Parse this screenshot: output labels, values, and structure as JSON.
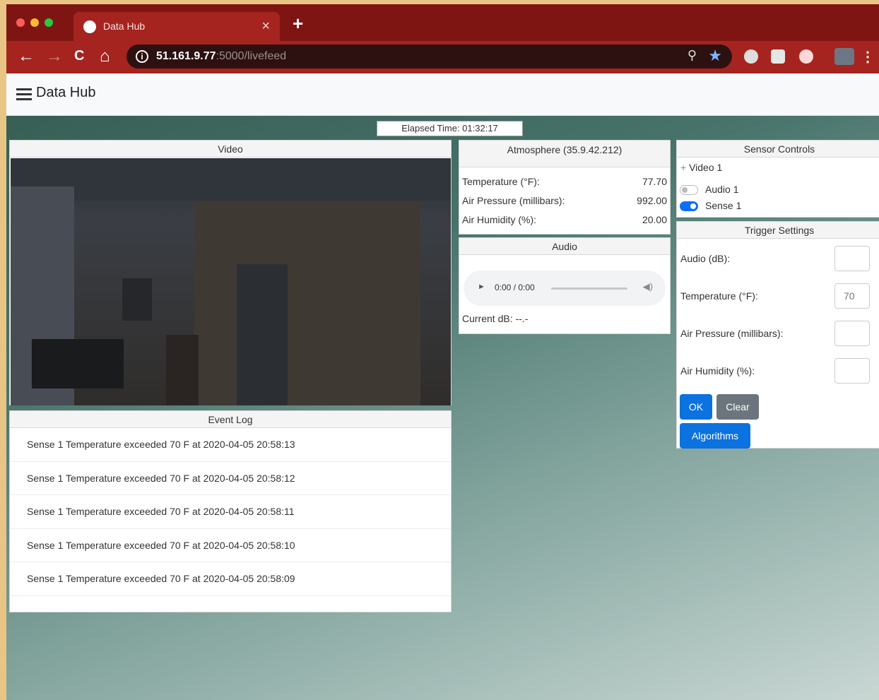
{
  "browser": {
    "tab_title": "Data Hub",
    "tab_close": "×",
    "new_tab": "+",
    "url_host": "51.161.9.77",
    "url_path": ":5000/livefeed",
    "info_glyph": "i",
    "icons": {
      "back": "←",
      "forward": "→",
      "reload": "C",
      "home": "⌂",
      "search": "⚲",
      "star": "★",
      "menu": "⋮"
    }
  },
  "navbar": {
    "brand": "Data Hub"
  },
  "elapsed": {
    "label": "Elapsed Time: 01:32:17"
  },
  "video": {
    "header": "Video"
  },
  "event_log": {
    "header": "Event Log",
    "items": [
      "Sense 1 Temperature exceeded 70 F at 2020-04-05 20:58:13",
      "Sense 1 Temperature exceeded 70 F at 2020-04-05 20:58:12",
      "Sense 1 Temperature exceeded 70 F at 2020-04-05 20:58:11",
      "Sense 1 Temperature exceeded 70 F at 2020-04-05 20:58:10",
      "Sense 1 Temperature exceeded 70 F at 2020-04-05 20:58:09"
    ]
  },
  "atmosphere": {
    "header": "Atmosphere (35.9.42.212)",
    "rows": [
      {
        "label": "Temperature (°F):",
        "value": "77.70"
      },
      {
        "label": "Air Pressure (millibars):",
        "value": "992.00"
      },
      {
        "label": "Air Humidity (%):",
        "value": "20.00"
      }
    ]
  },
  "audio": {
    "header": "Audio",
    "play_glyph": "►",
    "time": "0:00 / 0:00",
    "volume_glyph": "◀)",
    "current_db": "Current dB: --.-"
  },
  "sensor_controls": {
    "header": "Sensor Controls",
    "video_item": "Video 1",
    "plus_glyph": "+",
    "audio_toggle": {
      "label": "Audio 1",
      "on": false
    },
    "sense_toggle": {
      "label": "Sense 1",
      "on": true
    }
  },
  "trigger_settings": {
    "header": "Trigger Settings",
    "fields": [
      {
        "label": "Audio (dB):",
        "value": ""
      },
      {
        "label": "Temperature (°F):",
        "value": "70"
      },
      {
        "label": "Air Pressure (millibars):",
        "value": ""
      },
      {
        "label": "Air Humidity (%):",
        "value": ""
      }
    ],
    "ok_label": "OK",
    "clear_label": "Clear",
    "algorithms_label": "Algorithms"
  },
  "colors": {
    "chrome_tabbar": "#7f1513",
    "chrome_toolbar": "#a52420",
    "primary": "#0b72df",
    "secondary": "#6c757d"
  }
}
